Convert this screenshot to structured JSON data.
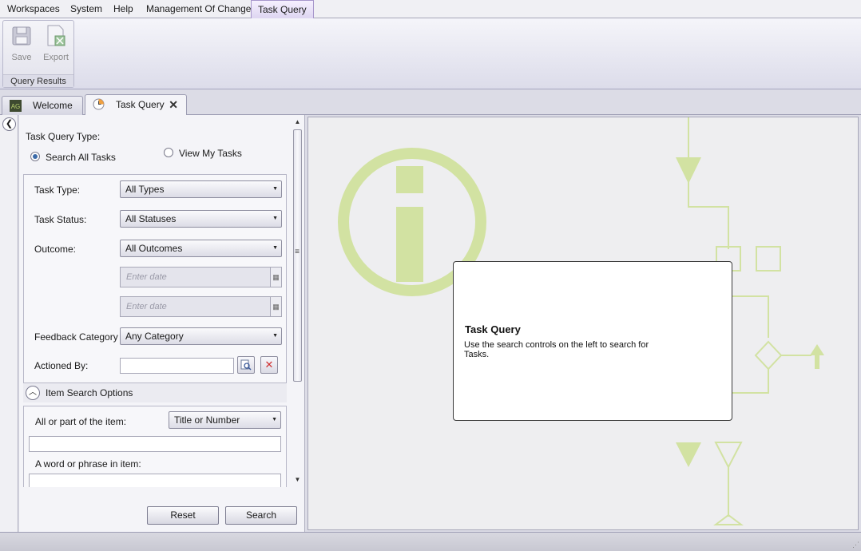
{
  "menu": {
    "items": [
      "Workspaces",
      "System",
      "Help",
      "Management Of Change"
    ],
    "active": "Task Query"
  },
  "ribbon": {
    "save_label": "Save",
    "export_label": "Export",
    "group_label": "Query Results"
  },
  "tabs": {
    "welcome": "Welcome",
    "task_query": "Task Query",
    "welcome_icon_text": "AG"
  },
  "form": {
    "query_type_label": "Task Query Type:",
    "search_all_label": "Search All Tasks",
    "view_my_label": "View My Tasks",
    "selected_query_type": "Search All Tasks",
    "task_type_label": "Task Type:",
    "task_type_value": "All Types",
    "task_status_label": "Task Status:",
    "task_status_value": "All Statuses",
    "outcome_label": "Outcome:",
    "outcome_value": "All Outcomes",
    "date_placeholder_1": "Enter date",
    "date_placeholder_2": "Enter date",
    "feedback_label": "Feedback Category",
    "feedback_value": "Any Category",
    "actioned_by_label": "Actioned By:",
    "actioned_by_value": ""
  },
  "item_search": {
    "header": "Item Search Options",
    "part_label": "All or part of the item:",
    "part_select_value": "Title or Number",
    "phrase_label": "A word or phrase in item:"
  },
  "buttons": {
    "reset": "Reset",
    "search": "Search"
  },
  "info": {
    "title": "Task Query",
    "message": "Use the search controls on the left to search for Tasks."
  },
  "colors": {
    "accent": "#a797cc",
    "watermark": "#d2e2a2",
    "panel_bg": "#eeeef0"
  }
}
